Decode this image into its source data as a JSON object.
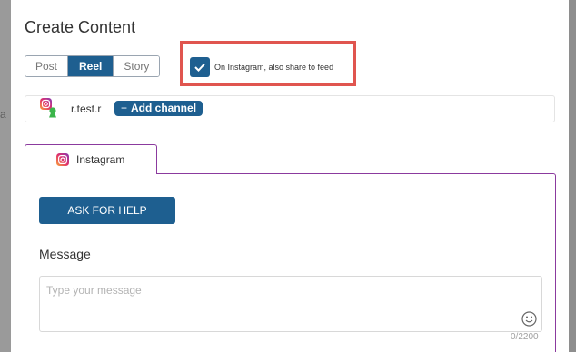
{
  "modal": {
    "title": "Create Content"
  },
  "content_types": [
    {
      "label": "Post",
      "active": false
    },
    {
      "label": "Reel",
      "active": true
    },
    {
      "label": "Story",
      "active": false
    }
  ],
  "share_option": {
    "label": "On Instagram, also share to feed",
    "checked": true
  },
  "channel_bar": {
    "account_name": "r.test.r",
    "add_channel_label": "Add channel"
  },
  "tabs": [
    {
      "label": "Instagram",
      "icon": "instagram-icon"
    }
  ],
  "ask_button": {
    "label": "ASK FOR HELP"
  },
  "message": {
    "label": "Message",
    "placeholder": "Type your message",
    "counter": "0/2200"
  },
  "background": {
    "ghost_text": "a"
  },
  "colors": {
    "primary": "#1e5f90",
    "highlight": "#e0554f",
    "tab_border": "#8b3a9e",
    "overlay": "#8e8e8e"
  }
}
